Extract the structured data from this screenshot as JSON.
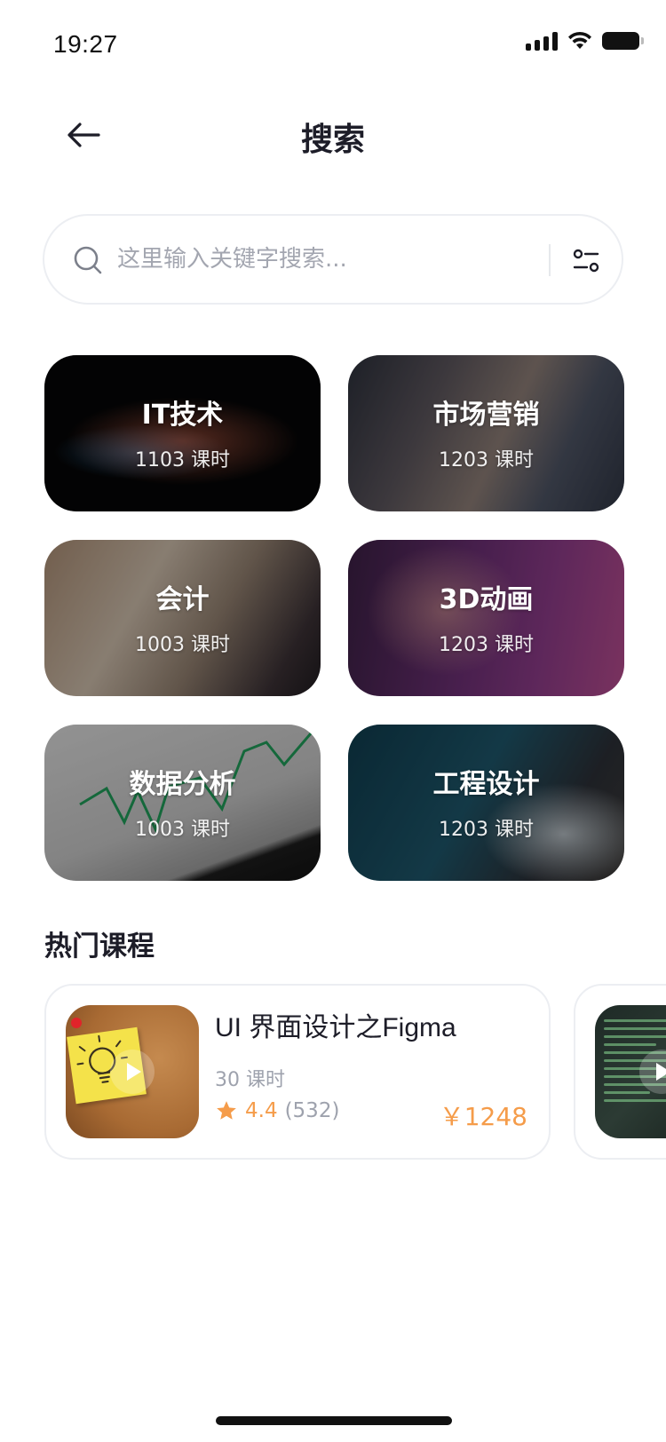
{
  "status_bar": {
    "time": "19:27"
  },
  "header": {
    "title": "搜索"
  },
  "search": {
    "placeholder": "这里输入关键字搜索..."
  },
  "categories": [
    {
      "name": "IT技术",
      "count": "1103 课时"
    },
    {
      "name": "市场营销",
      "count": "1203 课时"
    },
    {
      "name": "会计",
      "count": "1003 课时"
    },
    {
      "name": "3D动画",
      "count": "1203 课时"
    },
    {
      "name": "数据分析",
      "count": "1003 课时"
    },
    {
      "name": "工程设计",
      "count": "1203 课时"
    }
  ],
  "popular": {
    "title": "热门课程",
    "courses": [
      {
        "title": "UI 界面设计之Figma",
        "lessons": "30 课时",
        "rating": "4.4",
        "rating_count": "(532)",
        "price": "￥1248"
      }
    ]
  },
  "colors": {
    "accent": "#f59c4a",
    "text": "#1d1d28",
    "muted": "#9ea2ad",
    "border": "#eceef2"
  }
}
